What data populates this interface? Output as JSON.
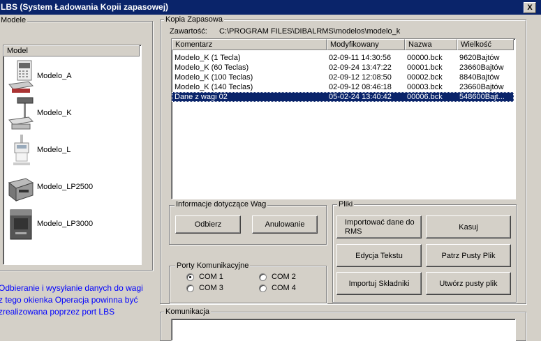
{
  "window": {
    "title": "LBS (System Ładowania Kopii zapasowej)",
    "close_label": "X"
  },
  "modele": {
    "group_label": "Modele",
    "column_header": "Model",
    "items": [
      {
        "label": "Modelo_A",
        "icon": "scale-tower-icon"
      },
      {
        "label": "Modelo_K",
        "icon": "scale-pole-icon"
      },
      {
        "label": "Modelo_L",
        "icon": "scale-hanging-icon"
      },
      {
        "label": "Modelo_LP2500",
        "icon": "label-printer-icon"
      },
      {
        "label": "Modelo_LP3000",
        "icon": "label-printer-large-icon"
      }
    ]
  },
  "help_text": "Odbieranie i wysyłanie danych do wagi z tego okienka Operacja powinna być zrealizowana poprzez port LBS",
  "kopia": {
    "group_label": "Kopia Zapasowa",
    "contents_label": "Zawartość:",
    "contents_path": "C:\\PROGRAM FILES\\DIBALRMS\\modelos\\modelo_k",
    "columns": [
      "Komentarz",
      "Modyfikowany",
      "Nazwa",
      "Wielkość"
    ],
    "rows": [
      {
        "komentarz": "Modelo_K (1 Tecla)",
        "modyfikowany": "02-09-11 14:30:56",
        "nazwa": "00000.bck",
        "wielkosc": "9620Bajtów",
        "selected": false
      },
      {
        "komentarz": "Modelo_K (60 Teclas)",
        "modyfikowany": "02-09-24 13:47:22",
        "nazwa": "00001.bck",
        "wielkosc": "23660Bajtów",
        "selected": false
      },
      {
        "komentarz": "Modelo_K (100 Teclas)",
        "modyfikowany": "02-09-12 12:08:50",
        "nazwa": "00002.bck",
        "wielkosc": "8840Bajtów",
        "selected": false
      },
      {
        "komentarz": "Modelo_K (140 Teclas)",
        "modyfikowany": "02-09-12 08:46:18",
        "nazwa": "00003.bck",
        "wielkosc": "23660Bajtów",
        "selected": false
      },
      {
        "komentarz": "Dane z wagi 02",
        "modyfikowany": "05-02-24 13:40:42",
        "nazwa": "00006.bck",
        "wielkosc": "548600Bajt...",
        "selected": true
      }
    ]
  },
  "wagi": {
    "group_label": "Informacje dotyczące Wag",
    "odbierz_label": "Odbierz",
    "anulowanie_label": "Anulowanie"
  },
  "porty": {
    "group_label": "Porty Komunikacyjne",
    "options": [
      {
        "label": "COM 1",
        "selected": true
      },
      {
        "label": "COM 2",
        "selected": false
      },
      {
        "label": "COM 3",
        "selected": false
      },
      {
        "label": "COM 4",
        "selected": false
      }
    ]
  },
  "pliki": {
    "group_label": "Pliki",
    "importuj_rms_label": "Importować dane do RMS",
    "kasuj_label": "Kasuj",
    "edycja_label": "Edycja Tekstu",
    "patrz_label": "Patrz Pusty Plik",
    "skladniki_label": "Importuj Składniki",
    "utworz_label": "Utwórz pusty plik"
  },
  "komunikacja": {
    "group_label": "Komunikacja"
  },
  "colors": {
    "title_bg": "#0a246a",
    "selection": "#0a246a",
    "help_text": "#0000ff",
    "face": "#d4d0c8"
  }
}
